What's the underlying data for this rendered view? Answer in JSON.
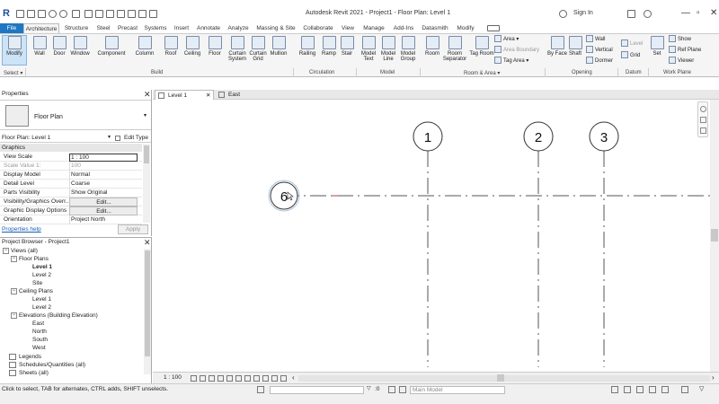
{
  "app": {
    "logo": "R",
    "title": "Autodesk Revit 2021 - Project1 - Floor Plan: Level 1",
    "sign_in": "Sign In"
  },
  "ribbon_tabs": [
    "File",
    "Architecture",
    "Structure",
    "Steel",
    "Precast",
    "Systems",
    "Insert",
    "Annotate",
    "Analyze",
    "Massing & Site",
    "Collaborate",
    "View",
    "Manage",
    "Add-Ins",
    "Datasmith",
    "Modify"
  ],
  "active_tab": "Architecture",
  "ribbon": {
    "modify": "Modify",
    "select": "Select ▾",
    "build_tools": [
      "Wall",
      "Door",
      "Window",
      "Component",
      "Column",
      "Roof",
      "Ceiling",
      "Floor",
      "Curtain System",
      "Curtain Grid",
      "Mullion"
    ],
    "build": "Build",
    "circulation_tools": [
      "Railing",
      "Ramp",
      "Stair"
    ],
    "circulation": "Circulation",
    "model_tools": [
      "Model Text",
      "Model Line",
      "Model Group"
    ],
    "model": "Model",
    "room_tools": [
      "Room",
      "Room Separator",
      "Tag Room"
    ],
    "room_small": [
      "Area ▾",
      "Area Boundary",
      "Tag Area ▾"
    ],
    "room_area": "Room & Area ▾",
    "opening_tools": [
      "By Face",
      "Shaft"
    ],
    "opening_small": [
      "Wall",
      "Vertical",
      "Dormer"
    ],
    "opening": "Opening",
    "datum_small": [
      "Level",
      "Grid"
    ],
    "datum": "Datum",
    "workplane_tools": [
      "Set"
    ],
    "workplane_small": [
      "Show",
      "Ref Plane",
      "Viewer"
    ],
    "workplane": "Work Plane"
  },
  "properties": {
    "title": "Properties",
    "type_name": "Floor Plan",
    "instance": "Floor Plan: Level 1",
    "edit_type": "Edit Type",
    "category": "Graphics",
    "rows": [
      {
        "name": "View Scale",
        "value": "1 : 100"
      },
      {
        "name": "Scale Value   1:",
        "value": "100"
      },
      {
        "name": "Display Model",
        "value": "Normal"
      },
      {
        "name": "Detail Level",
        "value": "Coarse"
      },
      {
        "name": "Parts Visibility",
        "value": "Show Original"
      },
      {
        "name": "Visibility/Graphics Overr...",
        "value": "Edit..."
      },
      {
        "name": "Graphic Display Options",
        "value": "Edit..."
      },
      {
        "name": "Orientation",
        "value": "Project North"
      }
    ],
    "help": "Properties help",
    "apply": "Apply"
  },
  "browser": {
    "title": "Project Browser - Project1",
    "items": [
      {
        "label": "Views (all)",
        "exp": "−"
      },
      {
        "label": "Floor Plans",
        "exp": "−"
      },
      {
        "label": "Level 1"
      },
      {
        "label": "Level 2"
      },
      {
        "label": "Site"
      },
      {
        "label": "Ceiling Plans",
        "exp": "−"
      },
      {
        "label": "Level 1"
      },
      {
        "label": "Level 2"
      },
      {
        "label": "Elevations (Building Elevation)",
        "exp": "−"
      },
      {
        "label": "East"
      },
      {
        "label": "North"
      },
      {
        "label": "South"
      },
      {
        "label": "West"
      },
      {
        "label": "Legends"
      },
      {
        "label": "Schedules/Quantities (all)"
      },
      {
        "label": "Sheets (all)"
      }
    ]
  },
  "view_tabs": [
    "Level 1",
    "East"
  ],
  "canvas": {
    "grids": [
      {
        "label": "1"
      },
      {
        "label": "2"
      },
      {
        "label": "3"
      }
    ],
    "horizontal_grid": "6"
  },
  "view_bar": {
    "scale": "1 : 100"
  },
  "status": {
    "text": "Click to select, TAB for alternates, CTRL adds, SHIFT unselects.",
    "zero": ":0",
    "model": "Main Model"
  }
}
